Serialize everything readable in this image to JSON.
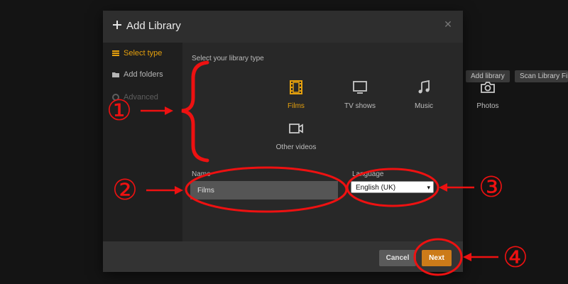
{
  "background": {
    "add_library_label": "Add library",
    "scan_library_label": "Scan Library Fil"
  },
  "dialog": {
    "title": "Add Library",
    "close_glyph": "✕"
  },
  "sidebar": {
    "items": [
      {
        "label": "Select type",
        "state": "active",
        "icon": "stack-icon"
      },
      {
        "label": "Add folders",
        "state": "normal",
        "icon": "folder-icon"
      },
      {
        "label": "Advanced",
        "state": "disabled",
        "icon": "gear-icon"
      }
    ]
  },
  "library_type": {
    "label": "Select your library type",
    "types": [
      {
        "label": "Films",
        "icon": "film-icon",
        "selected": true
      },
      {
        "label": "TV shows",
        "icon": "tv-icon",
        "selected": false
      },
      {
        "label": "Music",
        "icon": "music-icon",
        "selected": false
      },
      {
        "label": "Photos",
        "icon": "camera-icon",
        "selected": false
      },
      {
        "label": "Other videos",
        "icon": "video-camera-icon",
        "selected": false
      }
    ]
  },
  "form": {
    "name_label": "Name",
    "name_value": "Films",
    "language_label": "Language",
    "language_value": "English (UK)"
  },
  "footer": {
    "cancel_label": "Cancel",
    "next_label": "Next"
  },
  "annotations": {
    "markers": [
      "①",
      "②",
      "③",
      "④"
    ]
  },
  "colors": {
    "accent": "#e5a00d",
    "next_button": "#cc7b19",
    "annotation": "#e11111"
  }
}
